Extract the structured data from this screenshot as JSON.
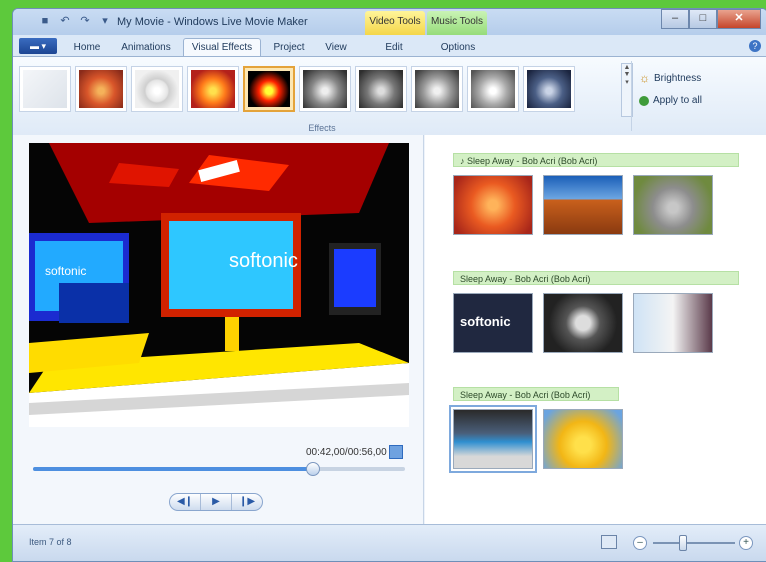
{
  "window": {
    "title": "My Movie - Windows Live Movie Maker"
  },
  "context_tabs": {
    "video_tools": "Video Tools",
    "music_tools": "Music Tools"
  },
  "tabs": [
    "Home",
    "Animations",
    "Visual Effects",
    "Project",
    "View",
    "Edit",
    "Options"
  ],
  "active_tab": "Visual Effects",
  "ribbon": {
    "group_label": "Effects",
    "brightness_label": "Brightness",
    "apply_all_label": "Apply to all",
    "effects": [
      {
        "name": "no-effect"
      },
      {
        "name": "warm"
      },
      {
        "name": "pixelate"
      },
      {
        "name": "posterize"
      },
      {
        "name": "threshold",
        "selected": true
      },
      {
        "name": "grayscale"
      },
      {
        "name": "sepia"
      },
      {
        "name": "blur"
      },
      {
        "name": "sharpen"
      },
      {
        "name": "cyanotone"
      }
    ]
  },
  "preview": {
    "timecode": "00:42,00/00:56,00",
    "progress": 0.75,
    "video_text_left": "softonic",
    "video_text_center": "softonic"
  },
  "storyboard": {
    "audio_tracks": [
      "♪ Sleep Away - Bob Acri (Bob Acri)",
      "Sleep Away - Bob Acri (Bob Acri)",
      "Sleep Away - Bob Acri (Bob Acri)"
    ],
    "clips": [
      {
        "name": "flower-orange"
      },
      {
        "name": "desert"
      },
      {
        "name": "koala"
      },
      {
        "name": "softonic-logo"
      },
      {
        "name": "jar-photo"
      },
      {
        "name": "chair-room"
      },
      {
        "name": "office-monitors"
      },
      {
        "name": "tulips"
      }
    ],
    "clip_text": "softonic"
  },
  "status": {
    "item_text": "Item 7 of 8",
    "zoom_level": 0.35
  }
}
